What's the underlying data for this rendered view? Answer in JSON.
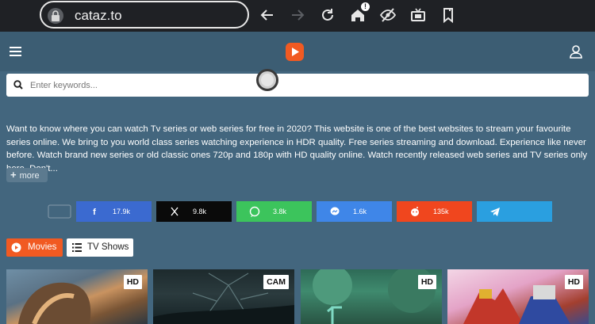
{
  "browser": {
    "url": "cataz.to",
    "icons": [
      "lock-icon",
      "back-icon",
      "forward-icon",
      "reload-icon",
      "home-icon",
      "hide-icon",
      "tv-icon",
      "bookmark-icon"
    ]
  },
  "header": {
    "menu_icon": "hamburger-icon",
    "logo_icon": "play-logo-icon",
    "user_icon": "user-icon"
  },
  "search": {
    "placeholder": "Enter keywords..."
  },
  "intro": {
    "text": "Want to know where you can watch Tv series or web series for free in 2020? This website is one of the best websites to stream your favourite series online. We bring to you world class series watching experience in HDR quality. Free series streaming and download. Experience like never before. Watch brand new series or old classic ones 720p and 180p with HD quality online. Watch recently released web series and TV series only here. Don't...",
    "more_label": "more"
  },
  "shares": [
    {
      "network": "facebook",
      "count": "17.9k",
      "color": "#3b6ad0"
    },
    {
      "network": "x",
      "count": "9.8k",
      "color": "#0a0a0a"
    },
    {
      "network": "whatsapp",
      "count": "3.8k",
      "color": "#3cc45c"
    },
    {
      "network": "messenger",
      "count": "1.6k",
      "color": "#3f86e8"
    },
    {
      "network": "reddit",
      "count": "135k",
      "color": "#f0461e"
    },
    {
      "network": "telegram",
      "count": "",
      "color": "#2a9fe0"
    }
  ],
  "categories": {
    "movies": "Movies",
    "tv_shows": "TV Shows"
  },
  "cards": [
    {
      "quality": "HD"
    },
    {
      "quality": "CAM"
    },
    {
      "quality": "HD"
    },
    {
      "quality": "HD"
    }
  ]
}
